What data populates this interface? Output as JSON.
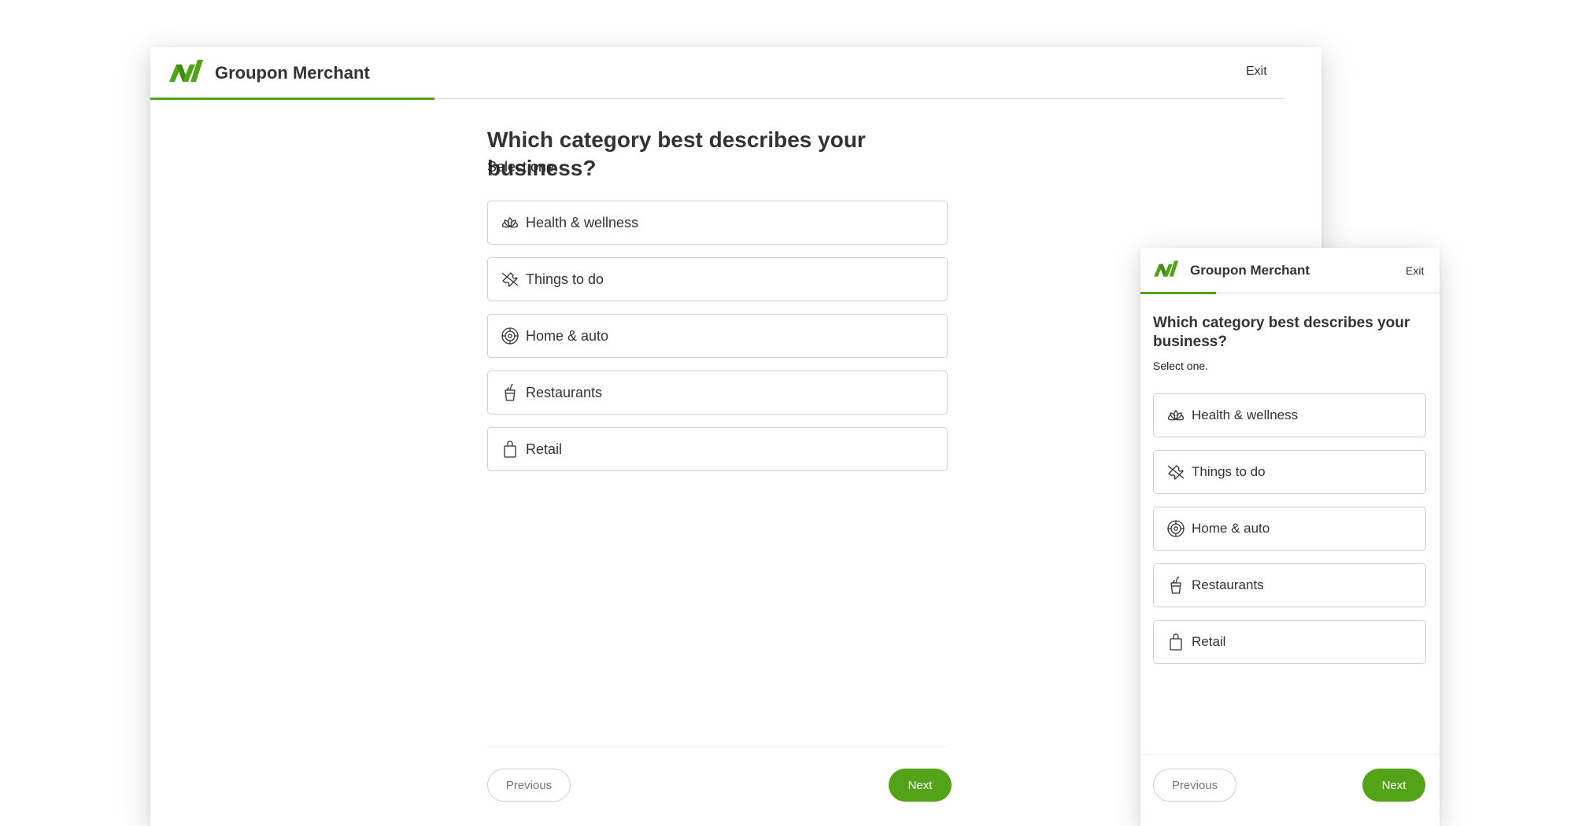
{
  "colors": {
    "accent": "#53a318",
    "border": "#cfcfcf",
    "text": "#333333"
  },
  "brand": {
    "logo_icon": "groupon-merchant-logo-icon",
    "name": "Groupon Merchant"
  },
  "header": {
    "exit_label": "Exit",
    "progress_percent": 25
  },
  "question": {
    "title": "Which category best describes your business?",
    "subtitle": "Select one."
  },
  "options": [
    {
      "label": "Health & wellness",
      "icon": "lotus-icon"
    },
    {
      "label": "Things to do",
      "icon": "ticket-icon"
    },
    {
      "label": "Home & auto",
      "icon": "tire-icon"
    },
    {
      "label": "Restaurants",
      "icon": "drink-cup-icon"
    },
    {
      "label": "Retail",
      "icon": "shopping-bag-icon"
    }
  ],
  "footer": {
    "previous_label": "Previous",
    "next_label": "Next"
  }
}
